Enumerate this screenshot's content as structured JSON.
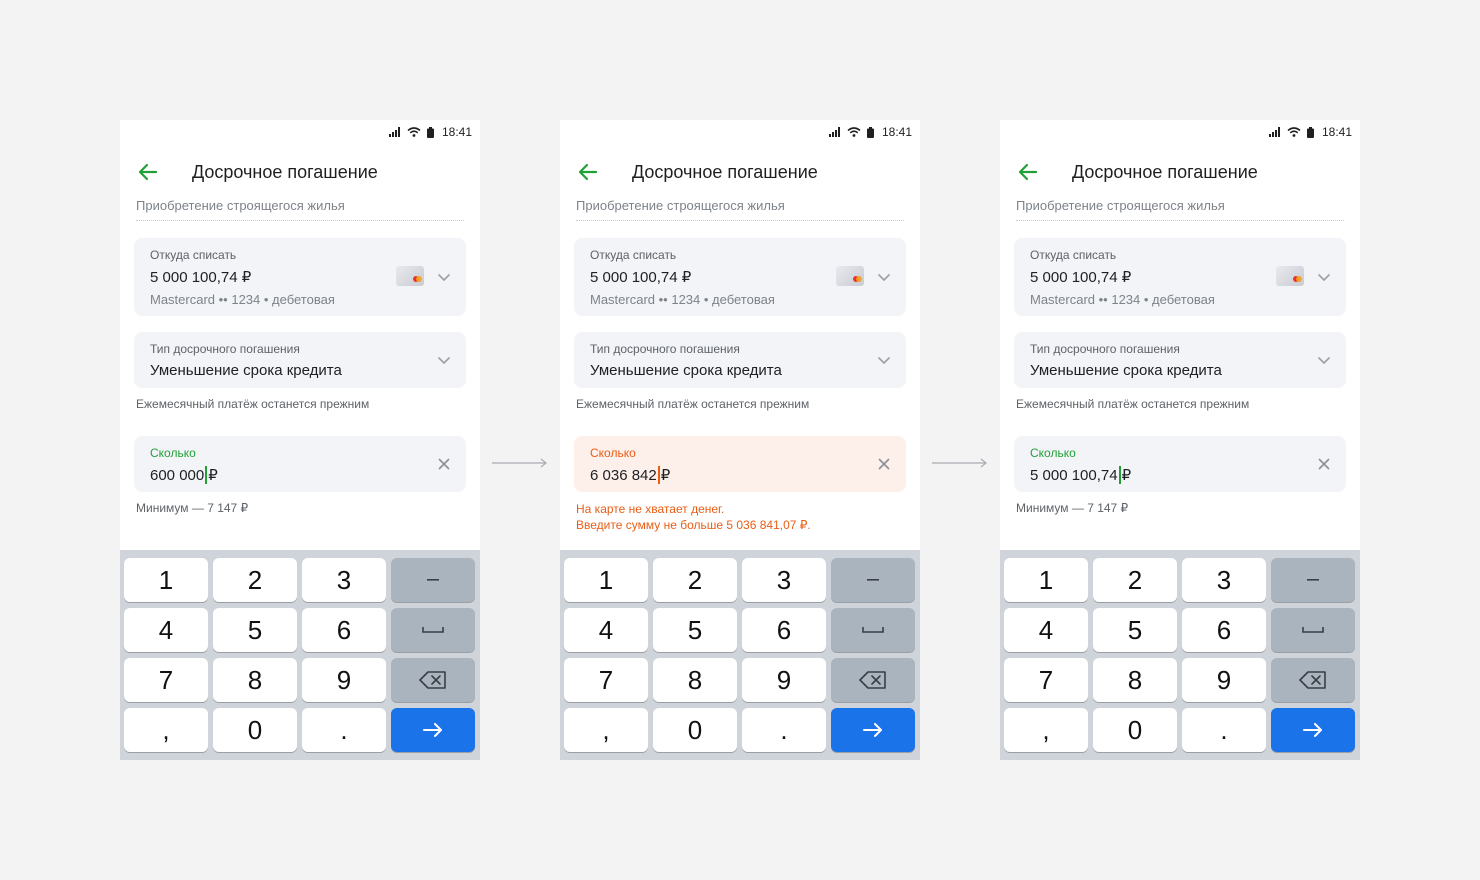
{
  "status": {
    "time": "18:41"
  },
  "common": {
    "title": "Досрочное погашение",
    "prev_text": "Приобретение строящегося жилья",
    "source_label": "Откуда списать",
    "source_amount": "5 000 100,74 ₽",
    "source_card": "Mastercard •• 1234 • дебетовая",
    "type_label": "Тип досрочного погашения",
    "type_value": "Уменьшение срока кредита",
    "monthly_hint": "Ежемесячный платёж останется прежним",
    "amount_label": "Сколько",
    "min_hint": "Минимум — 7 147 ₽",
    "currency": "₽"
  },
  "screens": [
    {
      "amount": "600 000",
      "state": "normal"
    },
    {
      "amount": "6 036 842",
      "state": "error",
      "error_line1": "На карте не хватает денег.",
      "error_line2": "Введите сумму не больше 5 036 841,07 ₽."
    },
    {
      "amount": "5 000 100,74",
      "state": "normal"
    }
  ],
  "keyboard": {
    "keys": [
      "1",
      "2",
      "3",
      "−",
      "4",
      "5",
      "6",
      "␣",
      "7",
      "8",
      "9",
      "⌫",
      ",",
      "0",
      ".",
      "→"
    ]
  },
  "colors": {
    "accent_green": "#21a038",
    "error_orange": "#e95d14",
    "error_bg": "#fdf0eb",
    "key_blue": "#1a73e8"
  }
}
